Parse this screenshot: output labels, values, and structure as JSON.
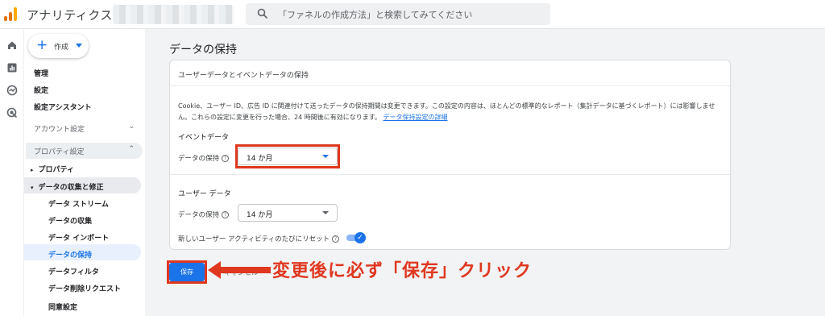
{
  "app": {
    "title": "アナリティクス",
    "logo_colors": [
      "#f9ab00",
      "#e37400",
      "#e37400"
    ]
  },
  "search": {
    "placeholder": "「ファネルの作成方法」と検索してみてください"
  },
  "rail": {
    "icons": [
      "home-icon",
      "reports-icon",
      "explore-icon",
      "advertising-icon"
    ]
  },
  "sidebar": {
    "create_label": "作成",
    "admin": "管理",
    "settings": "設定",
    "setup_assistant": "設定アシスタント",
    "account_settings": "アカウント設定",
    "property_settings": "プロパティ設定",
    "property": "プロパティ",
    "data_collection": "データの収集と修正",
    "items": [
      {
        "label": "データ ストリーム",
        "active": false
      },
      {
        "label": "データの収集",
        "active": false
      },
      {
        "label": "データ インポート",
        "active": false
      },
      {
        "label": "データの保持",
        "active": true
      },
      {
        "label": "データフィルタ",
        "active": false
      },
      {
        "label": "データ削除リクエスト",
        "active": false
      },
      {
        "label": "同意設定",
        "active": false
      }
    ]
  },
  "main": {
    "page_title": "データの保持",
    "card_title": "ユーザーデータとイベントデータの保持",
    "description": "Cookie、ユーザー ID、広告 ID に関連付けて送ったデータの保持期間は変更できます。この設定の内容は、ほとんどの標準的なレポート（集計データに基づくレポート）には影響しません。これらの設定に変更を行った場合、24 時間後に有効になります。",
    "description_link": "データ保持設定の詳細",
    "event_data": {
      "heading": "イベントデータ",
      "field_label": "データの保持",
      "value": "14 か月"
    },
    "user_data": {
      "heading": "ユーザー データ",
      "field_label": "データの保持",
      "value": "14 か月"
    },
    "reset_label": "新しいユーザー アクティビティのたびにリセット",
    "reset_enabled": true,
    "save_label": "保存",
    "cancel_label": "キャンセル",
    "annotation": "変更後に必ず「保存」クリック",
    "accent_color": "#1a73e8",
    "highlight_color": "#e0371f"
  }
}
